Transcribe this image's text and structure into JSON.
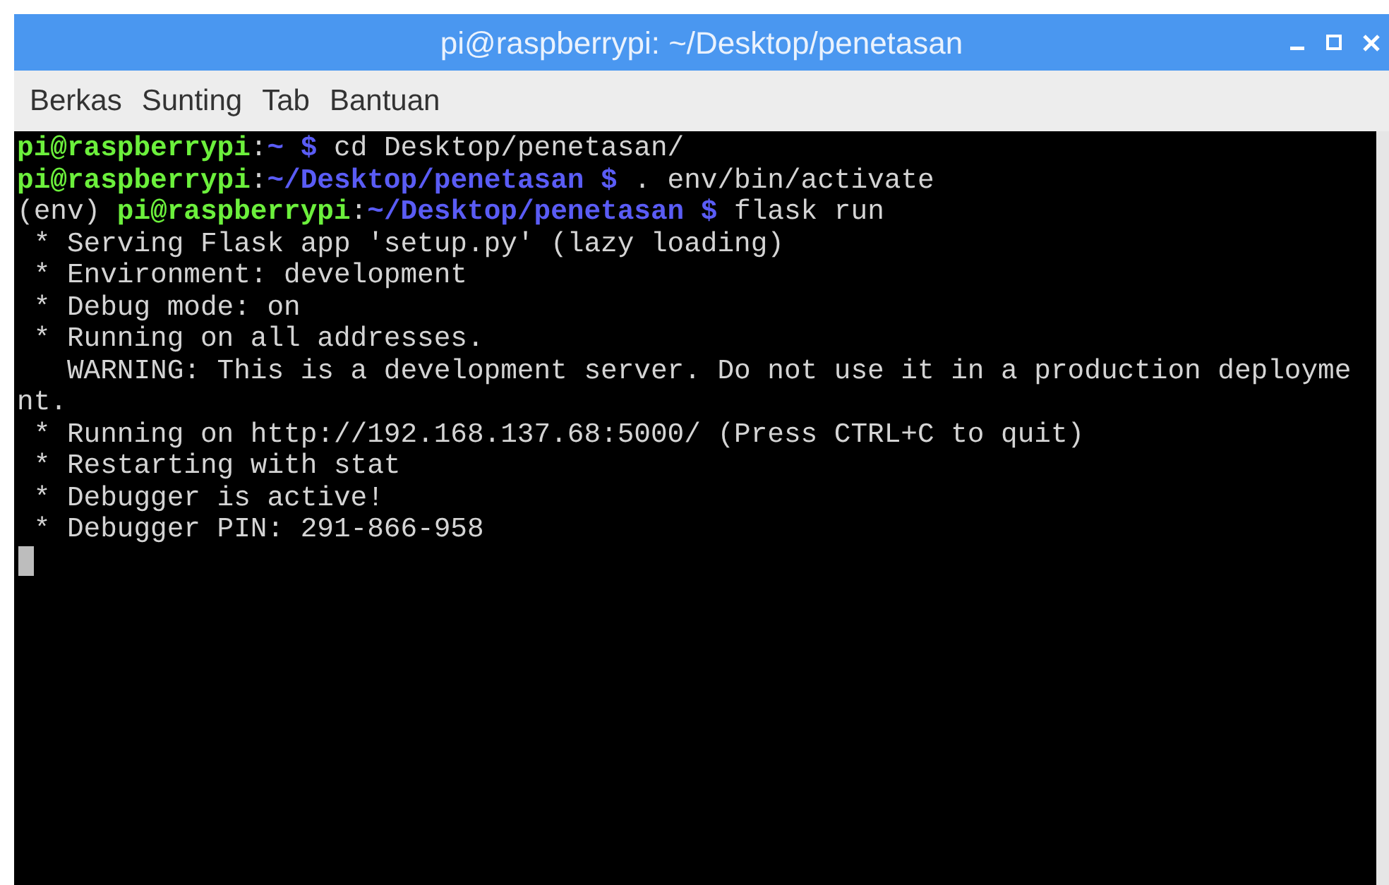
{
  "window": {
    "title": "pi@raspberrypi: ~/Desktop/penetasan"
  },
  "menu": [
    "Berkas",
    "Sunting",
    "Tab",
    "Bantuan"
  ],
  "terminal": {
    "lines": [
      [
        {
          "kind": "user",
          "text": "pi@raspberrypi"
        },
        {
          "kind": "plain",
          "text": ":"
        },
        {
          "kind": "path",
          "text": "~ $"
        },
        {
          "kind": "plain",
          "text": " cd Desktop/penetasan/"
        }
      ],
      [
        {
          "kind": "user",
          "text": "pi@raspberrypi"
        },
        {
          "kind": "plain",
          "text": ":"
        },
        {
          "kind": "path",
          "text": "~/Desktop/penetasan $"
        },
        {
          "kind": "plain",
          "text": " . env/bin/activate"
        }
      ],
      [
        {
          "kind": "plain",
          "text": "(env) "
        },
        {
          "kind": "user",
          "text": "pi@raspberrypi"
        },
        {
          "kind": "plain",
          "text": ":"
        },
        {
          "kind": "path",
          "text": "~/Desktop/penetasan $"
        },
        {
          "kind": "plain",
          "text": " flask run"
        }
      ],
      [
        {
          "kind": "plain",
          "text": " * Serving Flask app 'setup.py' (lazy loading)"
        }
      ],
      [
        {
          "kind": "plain",
          "text": " * Environment: development"
        }
      ],
      [
        {
          "kind": "plain",
          "text": " * Debug mode: on"
        }
      ],
      [
        {
          "kind": "plain",
          "text": " * Running on all addresses."
        }
      ],
      [
        {
          "kind": "plain",
          "text": "   WARNING: This is a development server. Do not use it in a production deployme"
        }
      ],
      [
        {
          "kind": "plain",
          "text": "nt."
        }
      ],
      [
        {
          "kind": "plain",
          "text": " * Running on http://192.168.137.68:5000/ (Press CTRL+C to quit)"
        }
      ],
      [
        {
          "kind": "plain",
          "text": " * Restarting with stat"
        }
      ],
      [
        {
          "kind": "plain",
          "text": " * Debugger is active!"
        }
      ],
      [
        {
          "kind": "plain",
          "text": " * Debugger PIN: 291-866-958"
        }
      ]
    ]
  }
}
